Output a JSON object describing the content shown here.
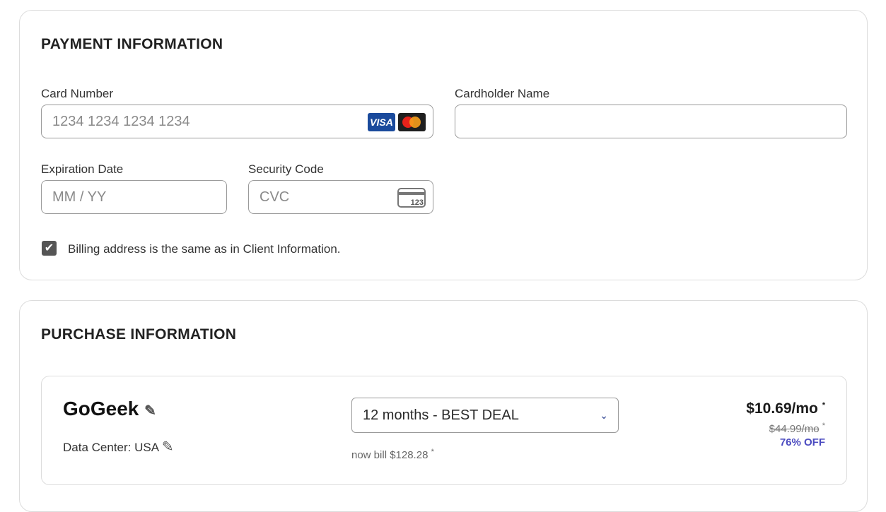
{
  "payment": {
    "title": "PAYMENT INFORMATION",
    "card_number": {
      "label": "Card Number",
      "placeholder": "1234 1234 1234 1234",
      "value": ""
    },
    "card_brands": [
      "VISA",
      "mastercard"
    ],
    "cardholder_name": {
      "label": "Cardholder Name",
      "placeholder": "",
      "value": ""
    },
    "expiration": {
      "label": "Expiration Date",
      "placeholder": "MM / YY",
      "value": ""
    },
    "security_code": {
      "label": "Security Code",
      "placeholder": "CVC",
      "value": "",
      "icon_text": "123"
    },
    "billing_same": {
      "label": "Billing address is the same as in Client Information.",
      "checked": true
    }
  },
  "purchase": {
    "title": "PURCHASE INFORMATION",
    "plan_name": "GoGeek",
    "data_center": "Data Center: USA",
    "period_selected": "12 months - BEST DEAL",
    "bill_note": "now bill $128.28",
    "price": "$10.69/mo",
    "old_price": "$44.99/mo",
    "discount": "76% OFF",
    "asterisk": "*"
  },
  "colors": {
    "accent": "#4b4bc0",
    "border": "#dcdcdc",
    "input_border": "#9a9a9a",
    "visa_blue": "#1a4a9c"
  },
  "icons": [
    "visa-logo",
    "mastercard-logo",
    "card-cvc-icon",
    "checkmark-icon",
    "pencil-icon",
    "chevron-down-icon"
  ]
}
